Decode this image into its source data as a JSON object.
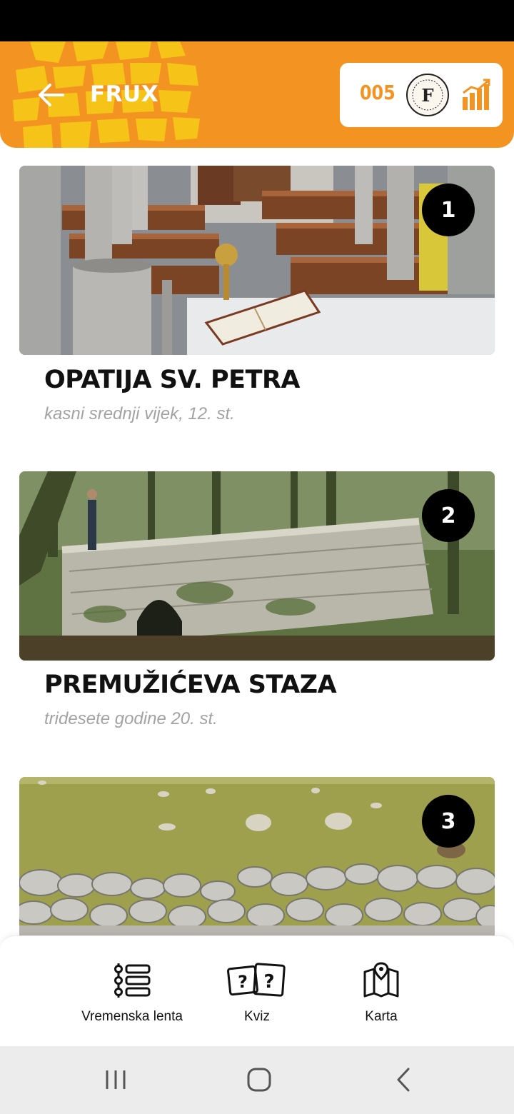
{
  "header": {
    "title": "FRUX",
    "score": "005",
    "seal_letter": "F",
    "accent_color": "#f39322"
  },
  "places": [
    {
      "number": "1",
      "title": "OPATIJA SV. PETRA",
      "subtitle": "kasni srednji vijek, 12. st."
    },
    {
      "number": "2",
      "title": "PREMUŽIĆEVA STAZA",
      "subtitle": "tridesete godine 20. st."
    },
    {
      "number": "3",
      "title": "",
      "subtitle": ""
    }
  ],
  "bottom_nav": [
    {
      "label": "Vremenska lenta",
      "icon": "timeline-icon"
    },
    {
      "label": "Kviz",
      "icon": "quiz-icon"
    },
    {
      "label": "Karta",
      "icon": "map-icon"
    }
  ],
  "system_nav": [
    "recents-icon",
    "home-icon",
    "back-icon"
  ]
}
